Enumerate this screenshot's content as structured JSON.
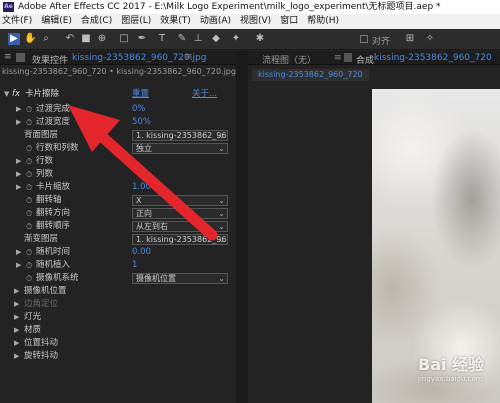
{
  "app": {
    "title": "Adobe After Effects CC 2017 - E:\\Milk Logo Experiment\\milk_logo_experiment\\无标题项目.aep *",
    "icon_text": "Ae"
  },
  "menu": [
    "文件(F)",
    "编辑(E)",
    "合成(C)",
    "图层(L)",
    "效果(T)",
    "动画(A)",
    "视图(V)",
    "窗口",
    "帮助(H)"
  ],
  "toolbar": {
    "align_label": "对齐",
    "icons": [
      "select-tool-icon",
      "hand-tool-icon",
      "zoom-tool-icon",
      "rotate-tool-icon",
      "camera-tool-icon",
      "pan-behind-tool-icon",
      "rect-mask-tool-icon",
      "pen-tool-icon",
      "text-tool-icon",
      "brush-tool-icon",
      "clone-stamp-tool-icon",
      "eraser-tool-icon",
      "roto-brush-tool-icon",
      "puppet-tool-icon"
    ]
  },
  "effect_panel": {
    "tab_label": "效果控件",
    "tab_file": "kissing-2353862_960_720.jpg",
    "subtitle": "kissing-2353862_960_720 • kissing-2353862_960_720.jpg",
    "effect_name": "卡片擦除",
    "reset": "重置",
    "about": "关于...",
    "rows": [
      {
        "label": "过渡完成",
        "value": "0%",
        "kind": "value",
        "indent": 36,
        "tri": true,
        "sw": true
      },
      {
        "label": "过渡宽度",
        "value": "50%",
        "kind": "value",
        "indent": 36,
        "tri": true,
        "sw": true
      },
      {
        "label": "背面图层",
        "value": "1. kissing-2353862_960",
        "kind": "dropdown",
        "indent": 24,
        "tri": false,
        "sw": false
      },
      {
        "label": "行数和列数",
        "value": "独立",
        "kind": "dropdown",
        "indent": 36,
        "tri": false,
        "sw": true
      },
      {
        "label": "行数",
        "value": "",
        "kind": "value",
        "indent": 36,
        "tri": true,
        "sw": true
      },
      {
        "label": "列数",
        "value": "",
        "kind": "value",
        "indent": 36,
        "tri": true,
        "sw": true
      },
      {
        "label": "卡片缩放",
        "value": "1.00",
        "kind": "value",
        "indent": 36,
        "tri": true,
        "sw": true
      },
      {
        "label": "翻转轴",
        "value": "X",
        "kind": "dropdown",
        "indent": 36,
        "tri": false,
        "sw": true
      },
      {
        "label": "翻转方向",
        "value": "正向",
        "kind": "dropdown",
        "indent": 36,
        "tri": false,
        "sw": true
      },
      {
        "label": "翻转顺序",
        "value": "从左到右",
        "kind": "dropdown",
        "indent": 36,
        "tri": false,
        "sw": true
      },
      {
        "label": "渐变图层",
        "value": "1. kissing-2353862_960",
        "kind": "dropdown",
        "indent": 24,
        "tri": false,
        "sw": false
      },
      {
        "label": "随机时间",
        "value": "0.00",
        "kind": "value",
        "indent": 36,
        "tri": true,
        "sw": true
      },
      {
        "label": "随机植入",
        "value": "1",
        "kind": "value",
        "indent": 36,
        "tri": true,
        "sw": true
      },
      {
        "label": "摄像机系统",
        "value": "摄像机位置",
        "kind": "dropdown",
        "indent": 36,
        "tri": false,
        "sw": true
      },
      {
        "label": "摄像机位置",
        "value": "",
        "kind": "group",
        "indent": 24,
        "tri": true,
        "sw": false
      },
      {
        "label": "边角定位",
        "value": "",
        "kind": "group-dim",
        "indent": 24,
        "tri": true,
        "sw": false
      },
      {
        "label": "灯光",
        "value": "",
        "kind": "group",
        "indent": 24,
        "tri": true,
        "sw": false
      },
      {
        "label": "材质",
        "value": "",
        "kind": "group",
        "indent": 24,
        "tri": true,
        "sw": false
      },
      {
        "label": "位置抖动",
        "value": "",
        "kind": "group",
        "indent": 24,
        "tri": true,
        "sw": false
      },
      {
        "label": "旋转抖动",
        "value": "",
        "kind": "group",
        "indent": 24,
        "tri": true,
        "sw": false
      }
    ]
  },
  "comp_panel": {
    "flow_tab": "流程图（无）",
    "comp_tab_prefix": "合成",
    "comp_tab_name": "kissing-2353862_960_720",
    "sub_tab": "kissing-2353862_960_720"
  },
  "watermark": {
    "text": "Bai 经验",
    "url": "jingyan.baidu.com"
  }
}
